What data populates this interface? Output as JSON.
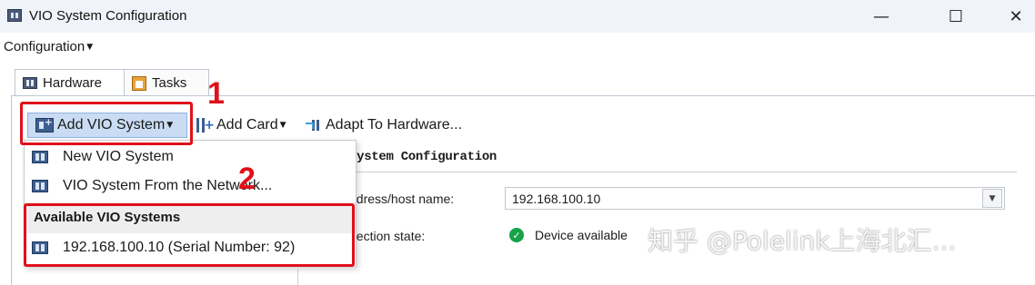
{
  "window": {
    "title": "VIO System Configuration",
    "controls": {
      "minimize": "—",
      "maximize": "☐",
      "close": "✕"
    }
  },
  "menu": {
    "configuration": "Configuration"
  },
  "tabs": [
    {
      "label": "Hardware",
      "icon": "hardware-icon"
    },
    {
      "label": "Tasks",
      "icon": "tasks-icon"
    }
  ],
  "toolbar": {
    "add_vio_system": "Add VIO System",
    "add_card": "Add Card",
    "adapt_to_hardware": "Adapt To Hardware..."
  },
  "dropdown": {
    "new_vio_system": "New VIO System",
    "from_network": "VIO System From the Network...",
    "available_header": "Available VIO Systems",
    "available_item": "192.168.100.10 (Serial Number: 92)"
  },
  "panel": {
    "section_title": "System Configuration",
    "address_label": "ddress/host name:",
    "address_value": "192.168.100.10",
    "connection_label": "nection state:",
    "connection_status": "Device available"
  },
  "annotations": {
    "step1": "1",
    "step2": "2"
  },
  "watermark": "知乎 @Polelink上海北汇...",
  "colors": {
    "annotation_red": "#e0101a",
    "selected_toolbar": "#c9dcf3",
    "status_green": "#16a34a"
  }
}
